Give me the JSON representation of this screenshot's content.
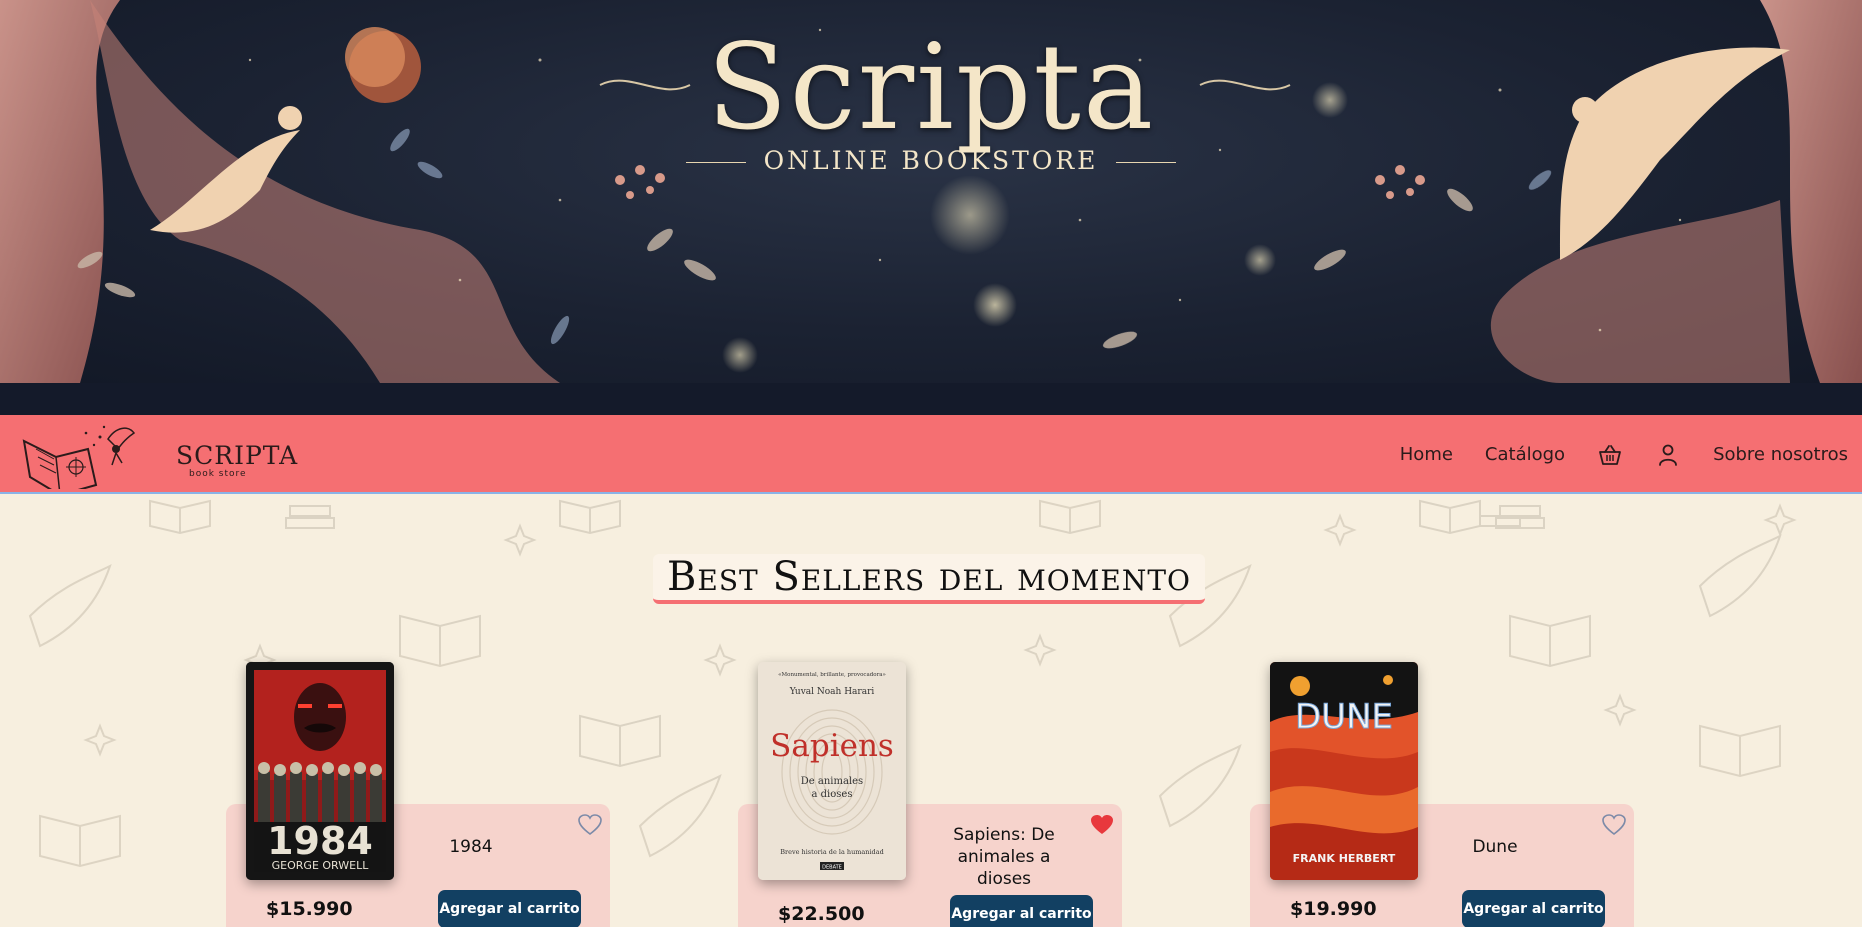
{
  "banner": {
    "title": "Scripta",
    "subtitle": "ONLINE BOOKSTORE"
  },
  "navbar": {
    "logo_text": "SCRIPTA",
    "logo_sub": "book store",
    "links": [
      {
        "label": "Home"
      },
      {
        "label": "Catálogo"
      },
      {
        "icon": "basket-icon"
      },
      {
        "icon": "user-icon"
      },
      {
        "label": "Sobre nosotros"
      }
    ]
  },
  "section": {
    "title": "Best Sellers del momento"
  },
  "books": [
    {
      "title": "1984",
      "author": "GEORGE ORWELL",
      "price": "$15.990",
      "button": "Agregar al carrito",
      "favorite": false
    },
    {
      "title": "Sapiens: De animales a dioses",
      "cover_top": "«Monumental, brillante, provocadora»",
      "author": "Yuval Noah Harari",
      "cover_title": "Sapiens",
      "cover_subtitle": "De animales a dioses",
      "cover_footer": "Breve historia de la humanidad",
      "publisher": "DEBATE",
      "price": "$22.500",
      "button": "Agregar al carrito",
      "favorite": true
    },
    {
      "title": "Dune",
      "cover_title": "DUNE",
      "author": "FRANK HERBERT",
      "price": "$19.990",
      "button": "Agregar al carrito",
      "favorite": false
    }
  ],
  "colors": {
    "navbar": "#f56f72",
    "card": "#f6d3cc",
    "button": "#124062",
    "heart_active": "#e8383d"
  }
}
